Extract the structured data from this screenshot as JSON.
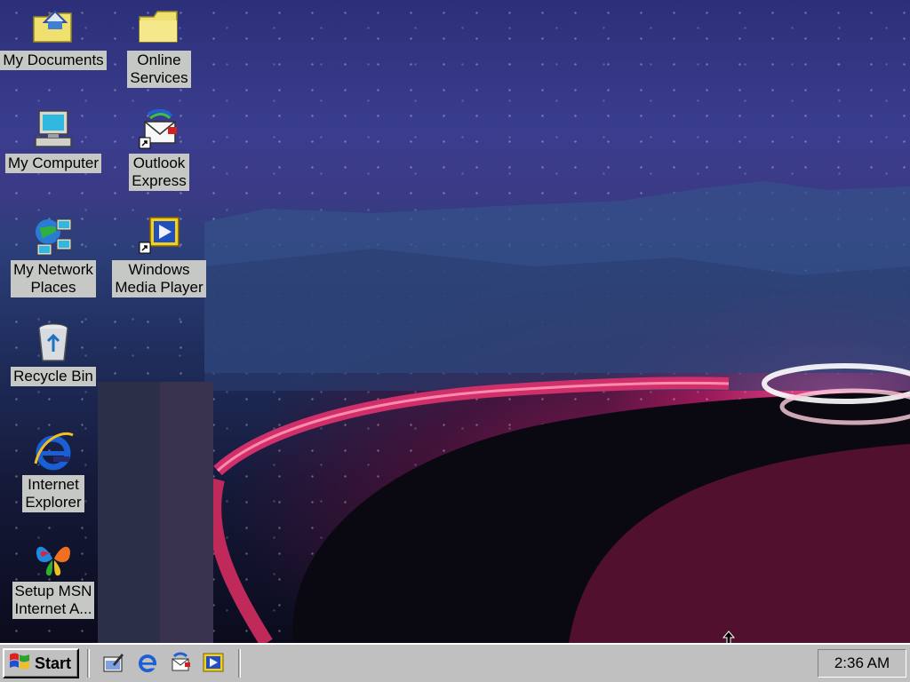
{
  "desktop": {
    "icons": [
      {
        "id": "my-documents",
        "label_line1": "My Documents",
        "label_line2": "",
        "icon": "folder-documents-icon"
      },
      {
        "id": "online-services",
        "label_line1": "Online",
        "label_line2": "Services",
        "icon": "folder-icon"
      },
      {
        "id": "my-computer",
        "label_line1": "My Computer",
        "label_line2": "",
        "icon": "computer-icon"
      },
      {
        "id": "outlook-express",
        "label_line1": "Outlook",
        "label_line2": "Express",
        "icon": "outlook-express-icon"
      },
      {
        "id": "my-network-places",
        "label_line1": "My Network",
        "label_line2": "Places",
        "icon": "network-icon"
      },
      {
        "id": "windows-media-player",
        "label_line1": "Windows",
        "label_line2": "Media Player",
        "icon": "media-player-icon"
      },
      {
        "id": "recycle-bin",
        "label_line1": "Recycle Bin",
        "label_line2": "",
        "icon": "recycle-bin-icon"
      },
      {
        "id": "internet-explorer",
        "label_line1": "Internet",
        "label_line2": "Explorer",
        "icon": "internet-explorer-icon"
      },
      {
        "id": "setup-msn",
        "label_line1": "Setup MSN",
        "label_line2": "Internet A...",
        "icon": "msn-butterfly-icon"
      }
    ]
  },
  "taskbar": {
    "start_label": "Start",
    "quick_launch": [
      "show-desktop-icon",
      "internet-explorer-icon",
      "outlook-express-icon",
      "media-player-icon"
    ],
    "clock": "2:36 AM"
  },
  "colors": {
    "taskbar": "#c0c0c0",
    "label_bg": "#c6c8c6",
    "ie_blue": "#1a5fd6",
    "folder_yellow": "#f0e070"
  }
}
